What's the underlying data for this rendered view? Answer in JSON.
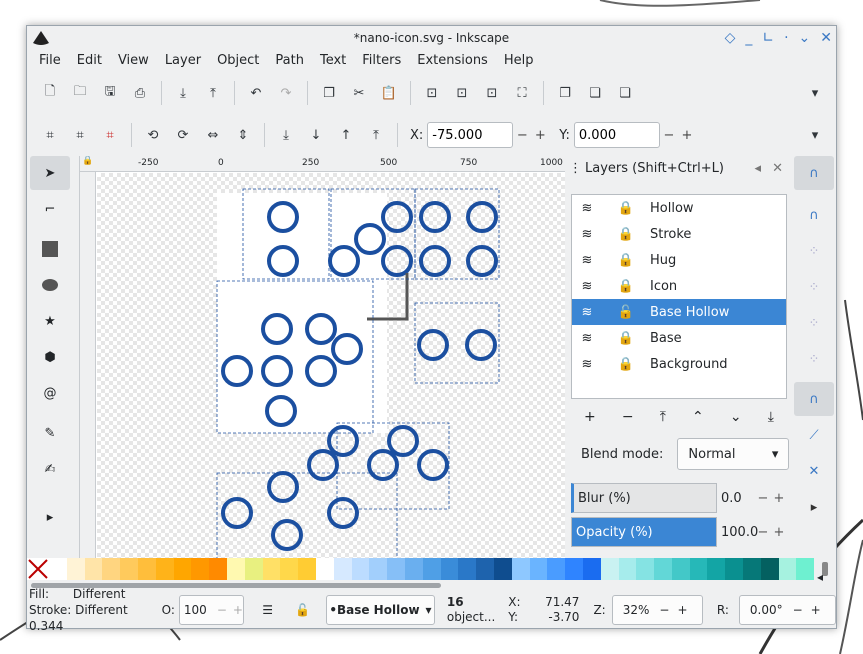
{
  "window": {
    "title": "*nano-icon.svg - Inkscape"
  },
  "menu": [
    "File",
    "Edit",
    "View",
    "Layer",
    "Object",
    "Path",
    "Text",
    "Filters",
    "Extensions",
    "Help"
  ],
  "toolbar_coords": {
    "x_label": "X:",
    "x_value": "-75.000",
    "y_label": "Y:",
    "y_value": "0.000"
  },
  "ruler": {
    "h_ticks": [
      "-250",
      "0",
      "250",
      "500",
      "750",
      "1000"
    ]
  },
  "layers": {
    "title": "Layers (Shift+Ctrl+L)",
    "items": [
      {
        "name": "Hollow",
        "selected": false
      },
      {
        "name": "Stroke",
        "selected": false
      },
      {
        "name": "Hug",
        "selected": false
      },
      {
        "name": "Icon",
        "selected": false
      },
      {
        "name": "Base Hollow",
        "selected": true
      },
      {
        "name": "Base",
        "selected": false
      },
      {
        "name": "Background",
        "selected": false
      }
    ],
    "blend_label": "Blend mode:",
    "blend_value": "Normal",
    "blur_label": "Blur (%)",
    "blur_value": "0.0",
    "opacity_label": "Opacity (%)",
    "opacity_value": "100.0"
  },
  "palette": [
    "#ffffff",
    "#fff3d6",
    "#ffe4a8",
    "#ffd580",
    "#ffca5c",
    "#ffbe3b",
    "#ffb319",
    "#ffa600",
    "#ff9800",
    "#ff8a00",
    "#fff9b0",
    "#e8f080",
    "#ffe066",
    "#ffd84a",
    "#ffcc33",
    "#ffffff",
    "#d6e9ff",
    "#bcdcff",
    "#a2cffc",
    "#86bff7",
    "#6aafef",
    "#4f9fe6",
    "#3a8cd9",
    "#2a78c8",
    "#1e63ad",
    "#0f4d8f",
    "#8ec8ff",
    "#6ab4ff",
    "#4a9cff",
    "#2f84ff",
    "#1a6cf0",
    "#c9f2f2",
    "#a6ecec",
    "#85e3e3",
    "#62d7d7",
    "#43c8c8",
    "#26b8b8",
    "#13a5a5",
    "#0a9090",
    "#067878",
    "#046060",
    "#a6f2e0",
    "#6ef0d0"
  ],
  "status": {
    "fill_label": "Fill:",
    "fill_value": "Different",
    "stroke_label": "Stroke:",
    "stroke_value": "Different 0.344",
    "opacity_label": "O:",
    "opacity_value": "100",
    "layer_value": "•Base Hollow",
    "objects_count": "16",
    "objects_text": "object...",
    "x_label": "X:",
    "x_value": "71.47",
    "y_label": "Y:",
    "y_value": "-3.70",
    "zoom_label": "Z:",
    "zoom_value": "32%",
    "rot_label": "R:",
    "rot_value": "0.00°"
  },
  "colors": {
    "accent": "#3b86d4",
    "molecule": "#1b4fa0"
  }
}
